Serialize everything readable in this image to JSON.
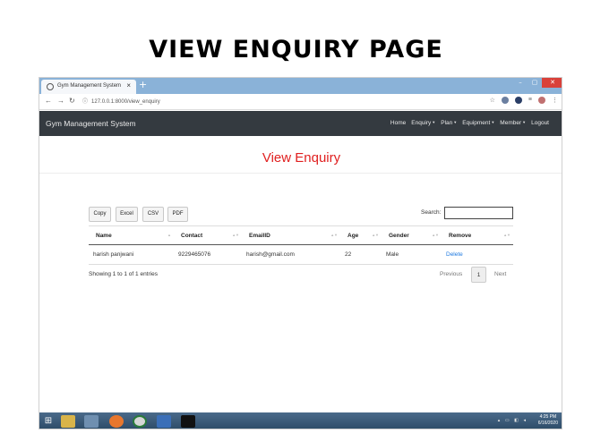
{
  "slide": {
    "title": "VIEW ENQUIRY PAGE"
  },
  "browser": {
    "tab_title": "Gym Management System",
    "tab_close": "×",
    "new_tab": "+",
    "window_controls": [
      "–",
      "▢",
      "✕"
    ],
    "url": "127.0.0.1:8000/view_enquiry",
    "nav_icons": [
      "back-arrow-icon",
      "forward-arrow-icon",
      "reload-icon"
    ]
  },
  "navbar": {
    "brand": "Gym Management System",
    "links": [
      {
        "label": "Home",
        "dropdown": false
      },
      {
        "label": "Enquiry",
        "dropdown": true
      },
      {
        "label": "Plan",
        "dropdown": true
      },
      {
        "label": "Equipment",
        "dropdown": true
      },
      {
        "label": "Member",
        "dropdown": true
      },
      {
        "label": "Logout",
        "dropdown": false
      }
    ]
  },
  "page": {
    "heading": "View Enquiry",
    "heading_color": "#e02020"
  },
  "toolbar": {
    "buttons": [
      "Copy",
      "Excel",
      "CSV",
      "PDF"
    ],
    "search_label": "Search:"
  },
  "table": {
    "columns": [
      "Name",
      "Contact",
      "EmailID",
      "Age",
      "Gender",
      "Remove"
    ],
    "rows": [
      {
        "name": "harish panjwani",
        "contact": "9229465076",
        "email": "harish@gmail.com",
        "age": "22",
        "gender": "Male",
        "remove": "Delete"
      }
    ]
  },
  "footer": {
    "info": "Showing 1 to 1 of 1 entries",
    "previous": "Previous",
    "current_page": "1",
    "next": "Next"
  },
  "taskbar": {
    "time": "4:25 PM",
    "date": "6/16/2020"
  }
}
